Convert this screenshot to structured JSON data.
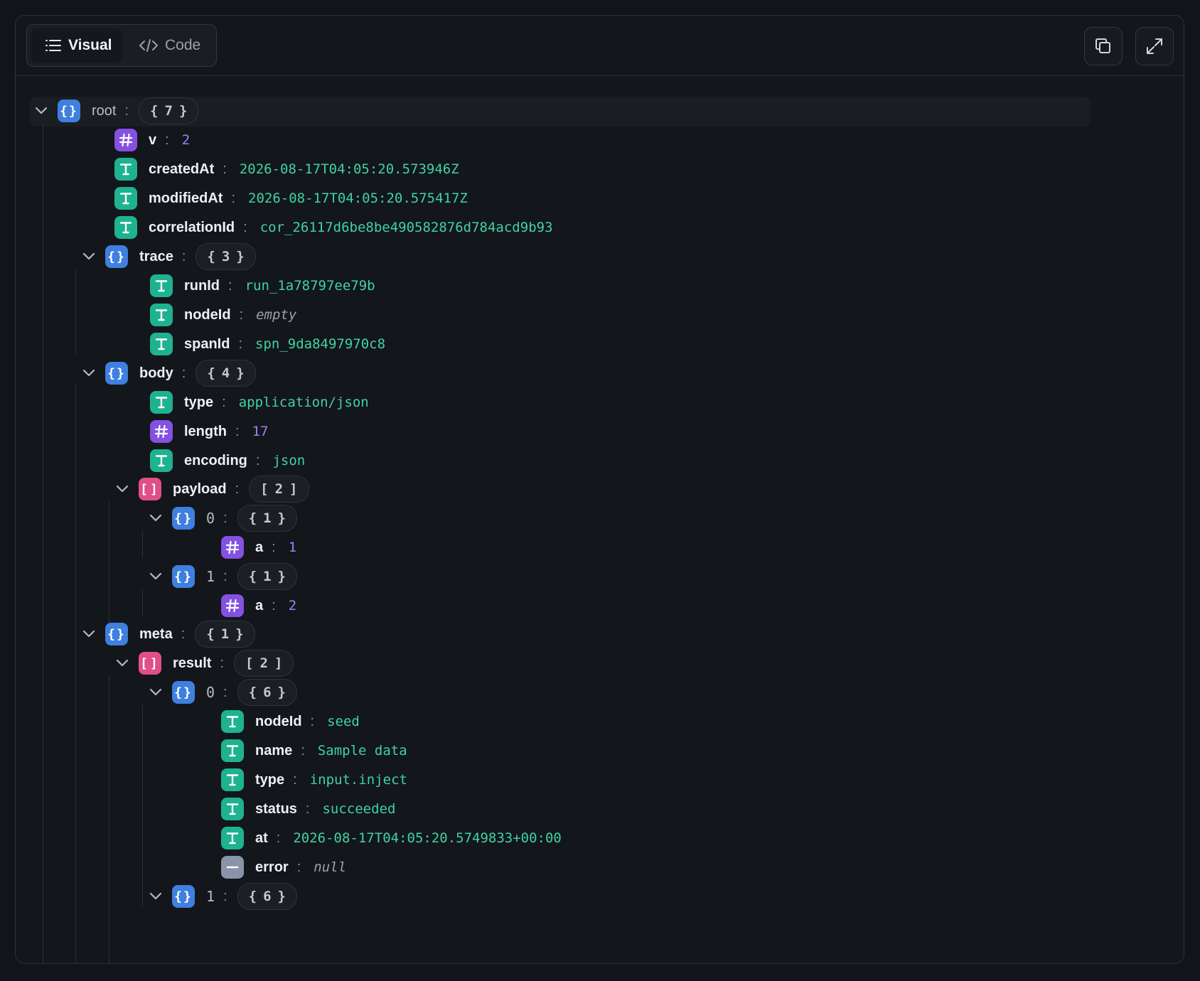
{
  "tabs": {
    "visual": "Visual",
    "code": "Code"
  },
  "header": {
    "copy_icon": "copy-icon",
    "expand_icon": "expand-icon"
  },
  "tree": {
    "root": {
      "key": "root",
      "count": "7",
      "open": "{",
      "close": "}"
    },
    "v": {
      "key": "v",
      "value": "2"
    },
    "createdAt": {
      "key": "createdAt",
      "value": "2026-08-17T04:05:20.573946Z"
    },
    "modifiedAt": {
      "key": "modifiedAt",
      "value": "2026-08-17T04:05:20.575417Z"
    },
    "correlationId": {
      "key": "correlationId",
      "value": "cor_26117d6be8be490582876d784acd9b93"
    },
    "trace": {
      "key": "trace",
      "count": "3",
      "open": "{",
      "close": "}"
    },
    "runId": {
      "key": "runId",
      "value": "run_1a78797ee79b"
    },
    "trace_nodeId": {
      "key": "nodeId",
      "value": "empty"
    },
    "spanId": {
      "key": "spanId",
      "value": "spn_9da8497970c8"
    },
    "body": {
      "key": "body",
      "count": "4",
      "open": "{",
      "close": "}"
    },
    "body_type": {
      "key": "type",
      "value": "application/json"
    },
    "length": {
      "key": "length",
      "value": "17"
    },
    "encoding": {
      "key": "encoding",
      "value": "json"
    },
    "payload": {
      "key": "payload",
      "count": "2",
      "open": "[",
      "close": "]"
    },
    "payload_0": {
      "key": "0",
      "count": "1",
      "open": "{",
      "close": "}"
    },
    "payload_0_a": {
      "key": "a",
      "value": "1"
    },
    "payload_1": {
      "key": "1",
      "count": "1",
      "open": "{",
      "close": "}"
    },
    "payload_1_a": {
      "key": "a",
      "value": "2"
    },
    "meta": {
      "key": "meta",
      "count": "1",
      "open": "{",
      "close": "}"
    },
    "result": {
      "key": "result",
      "count": "2",
      "open": "[",
      "close": "]"
    },
    "result_0": {
      "key": "0",
      "count": "6",
      "open": "{",
      "close": "}"
    },
    "r0_nodeId": {
      "key": "nodeId",
      "value": "seed"
    },
    "r0_name": {
      "key": "name",
      "value": "Sample data"
    },
    "r0_type": {
      "key": "type",
      "value": "input.inject"
    },
    "r0_status": {
      "key": "status",
      "value": "succeeded"
    },
    "r0_at": {
      "key": "at",
      "value": "2026-08-17T04:05:20.5749833+00:00"
    },
    "r0_error": {
      "key": "error",
      "value": "null"
    },
    "result_1": {
      "key": "1",
      "count": "6",
      "open": "{",
      "close": "}"
    }
  },
  "colors": {
    "object": "#3f7fdf",
    "array": "#e04f86",
    "number": "#8451e0",
    "string": "#1eb290",
    "null": "#8a94a8",
    "string_value": "#3fd3a3",
    "number_value": "#a57df7"
  }
}
